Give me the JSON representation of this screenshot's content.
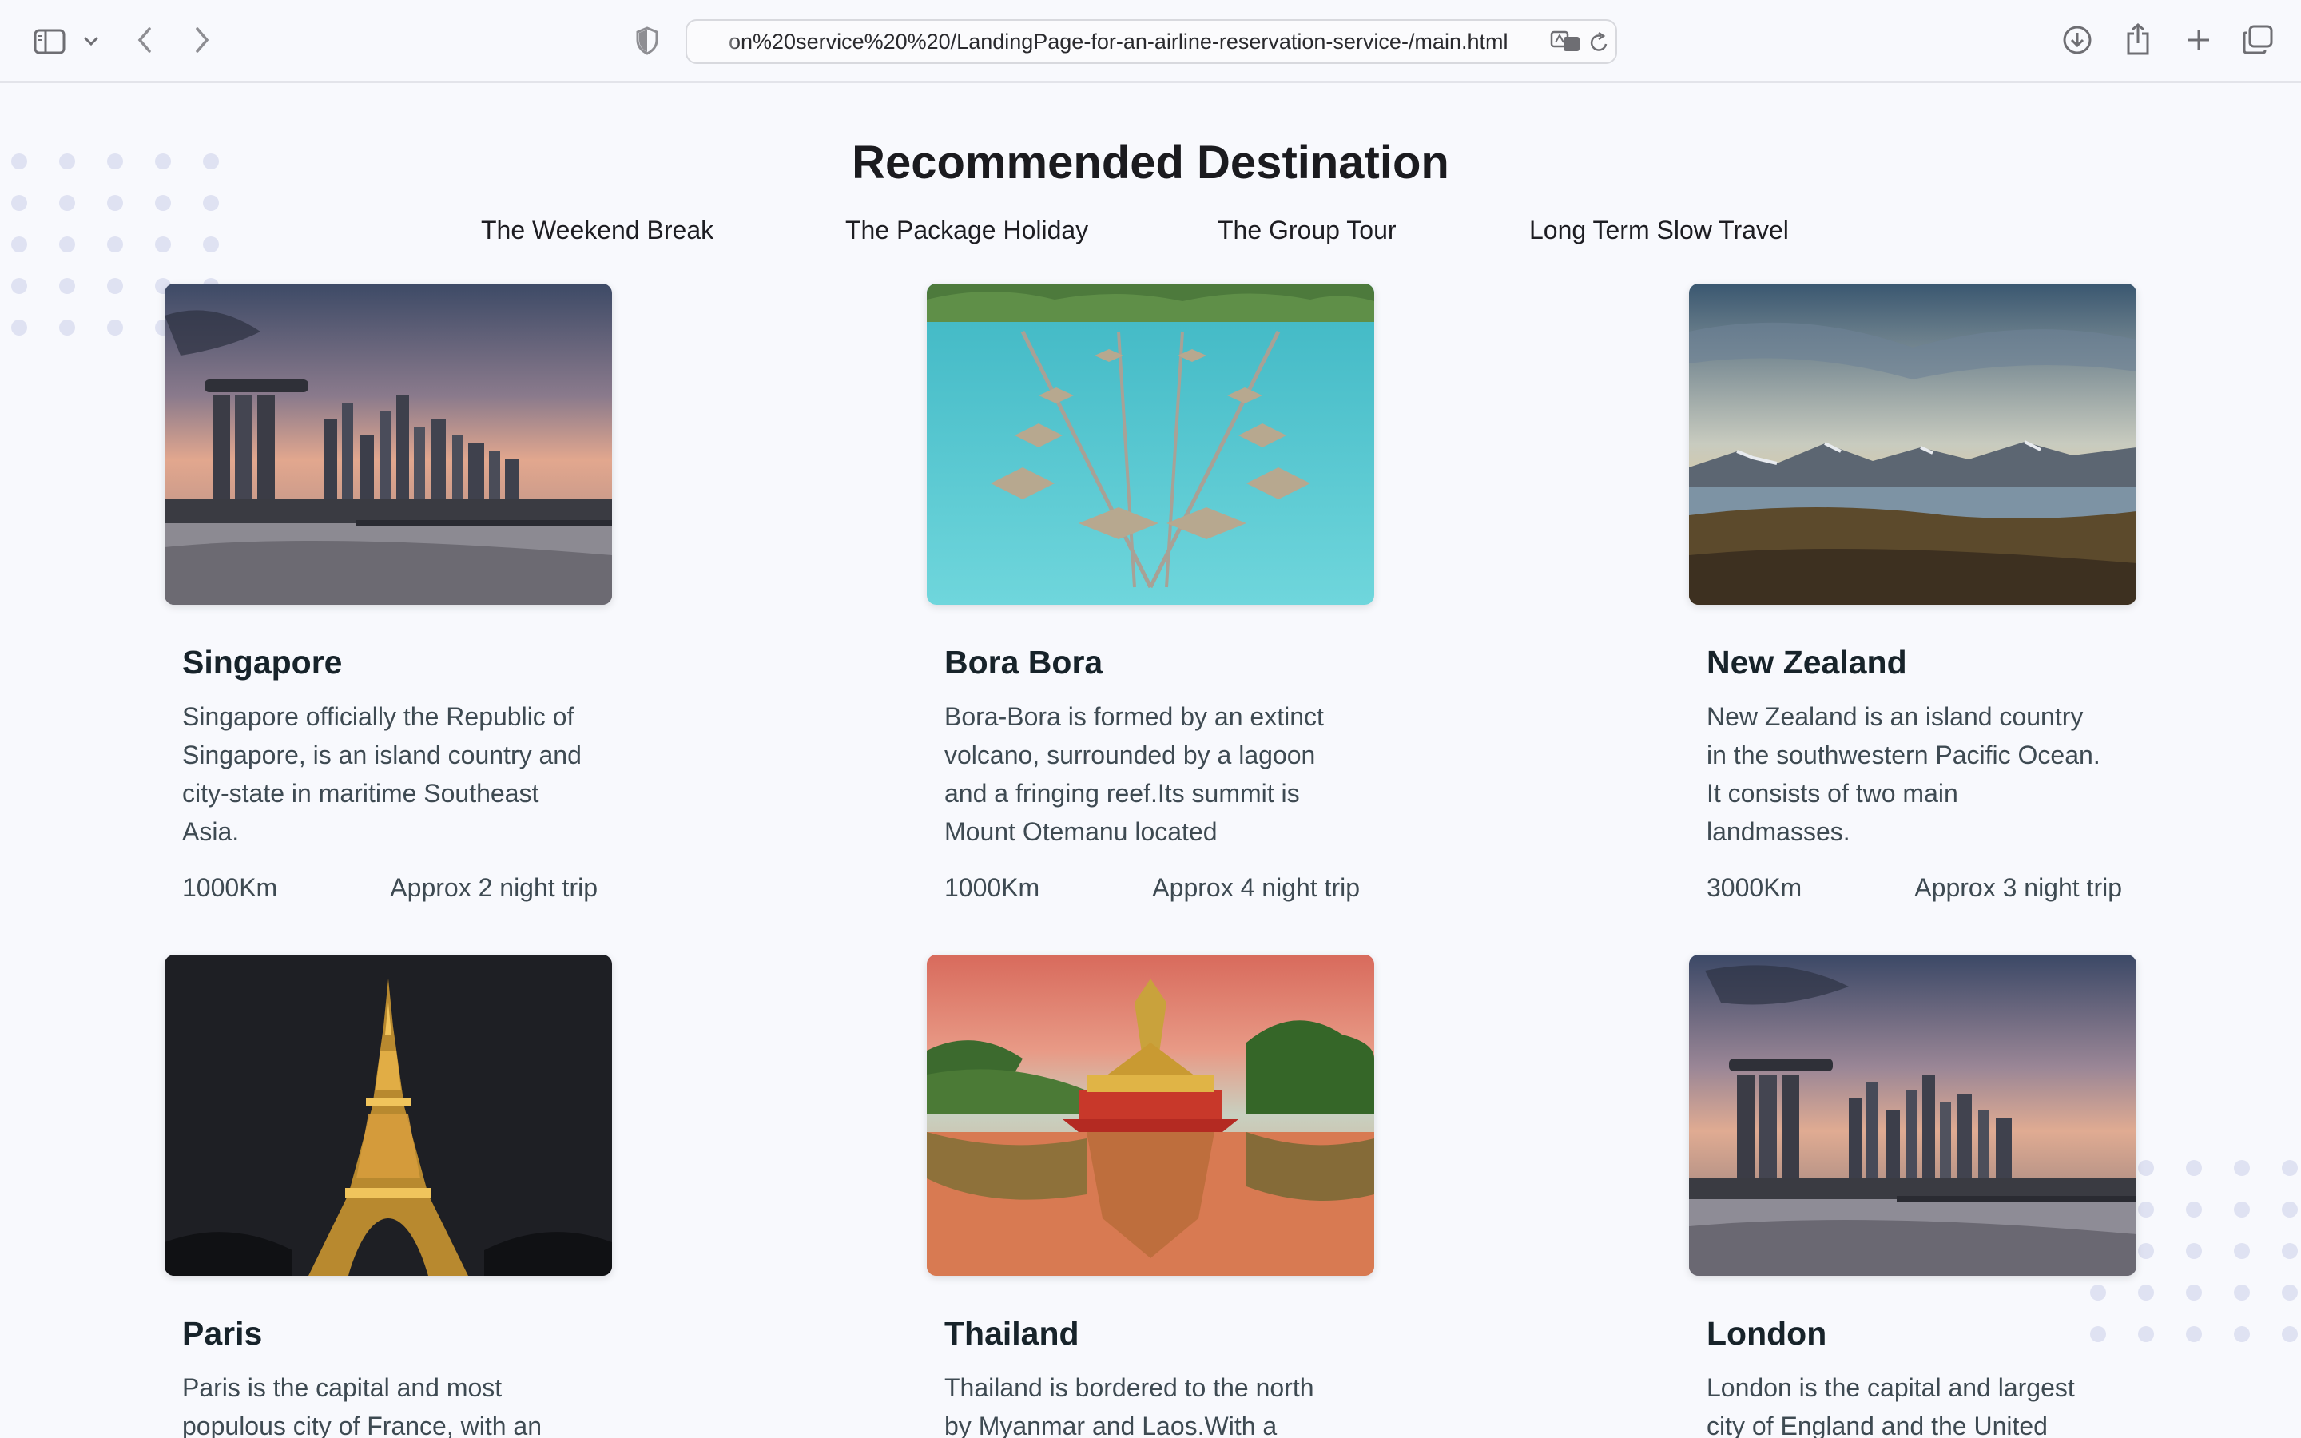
{
  "browser": {
    "url": "on%20service%20%20/LandingPage-for-an-airline-reservation-service-/main.html"
  },
  "section": {
    "title": "Recommended Destination",
    "tabs": [
      "The Weekend Break",
      "The Package Holiday",
      "The Group Tour",
      "Long Term Slow Travel"
    ]
  },
  "destinations": [
    {
      "name": "Singapore",
      "description": "Singapore officially the Republic of Singapore, is an island country and city-state in maritime Southeast Asia.",
      "distance": "1000Km",
      "trip": "Approx 2 night trip"
    },
    {
      "name": "Bora Bora",
      "description": "Bora-Bora is formed by an extinct volcano, surrounded by a lagoon and a fringing reef.Its summit is Mount Otemanu located",
      "distance": "1000Km",
      "trip": "Approx 4 night trip"
    },
    {
      "name": "New Zealand",
      "description": "New Zealand is an island country in the southwestern Pacific Ocean. It consists of two main landmasses.",
      "distance": "3000Km",
      "trip": "Approx 3 night trip"
    },
    {
      "name": "Paris",
      "description": "Paris is the capital and most populous city of France, with an"
    },
    {
      "name": "Thailand",
      "description": "Thailand is bordered to the north by Myanmar and Laos.With a"
    },
    {
      "name": "London",
      "description": "London is the capital and largest city of England and the United Kingdom,"
    }
  ]
}
